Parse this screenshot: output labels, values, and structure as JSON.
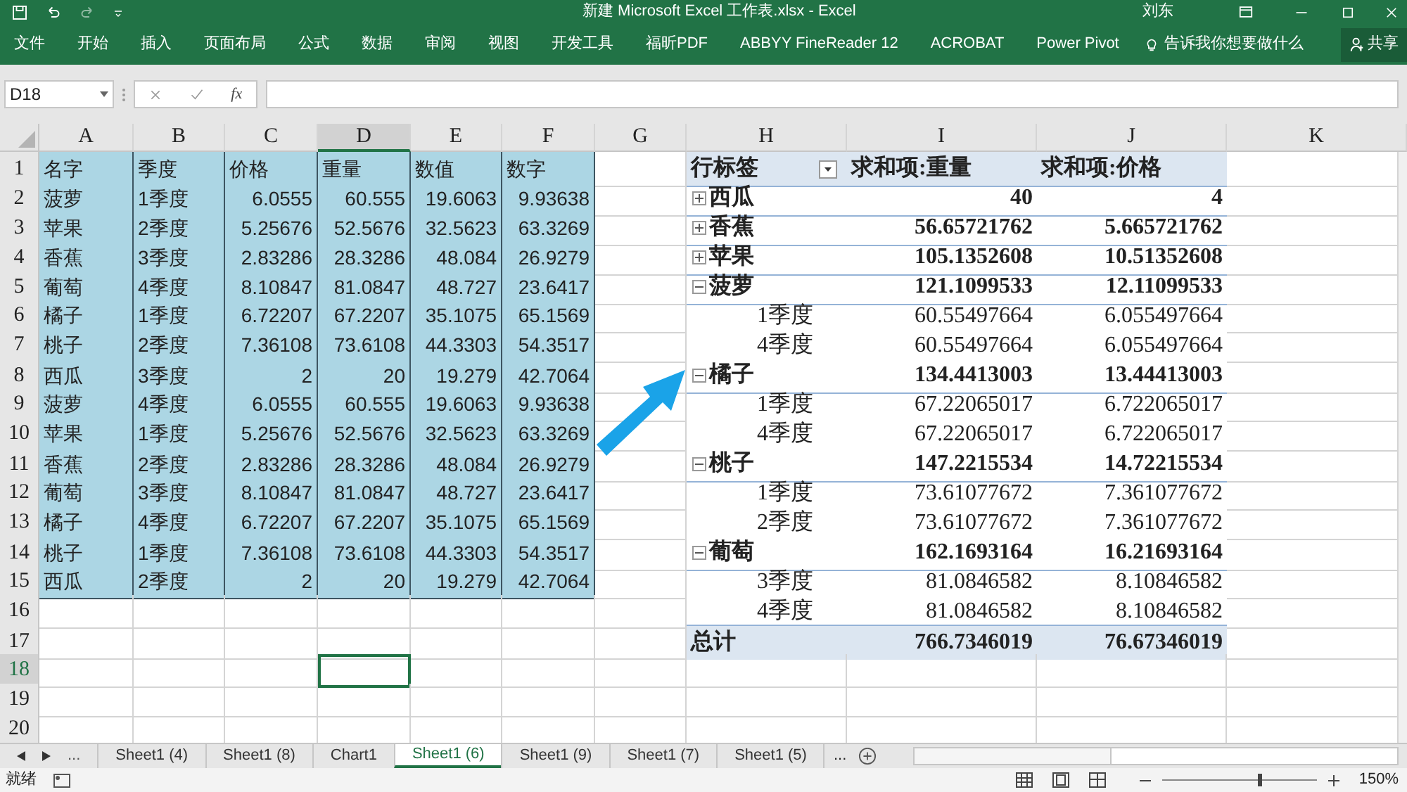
{
  "window": {
    "title": "新建 Microsoft Excel 工作表.xlsx  -  Excel",
    "user": "刘东"
  },
  "ribbon": {
    "tabs": [
      "文件",
      "开始",
      "插入",
      "页面布局",
      "公式",
      "数据",
      "审阅",
      "视图",
      "开发工具",
      "福昕PDF",
      "ABBYY FineReader 12",
      "ACROBAT",
      "Power Pivot"
    ],
    "tell_me": "告诉我你想要做什么",
    "share": "共享"
  },
  "formula_bar": {
    "name_box": "D18",
    "fx": "fx"
  },
  "columns": [
    {
      "label": "A",
      "selected": false
    },
    {
      "label": "B",
      "selected": false
    },
    {
      "label": "C",
      "selected": false
    },
    {
      "label": "D",
      "selected": true
    },
    {
      "label": "E",
      "selected": false
    },
    {
      "label": "F",
      "selected": false
    },
    {
      "label": "G",
      "selected": false
    },
    {
      "label": "H",
      "selected": false
    },
    {
      "label": "I",
      "selected": false
    },
    {
      "label": "J",
      "selected": false
    },
    {
      "label": "K",
      "selected": false
    }
  ],
  "row_numbers": [
    {
      "label": "1",
      "selected": false
    },
    {
      "label": "2",
      "selected": false
    },
    {
      "label": "3",
      "selected": false
    },
    {
      "label": "4",
      "selected": false
    },
    {
      "label": "5",
      "selected": false
    },
    {
      "label": "6",
      "selected": false
    },
    {
      "label": "7",
      "selected": false
    },
    {
      "label": "8",
      "selected": false
    },
    {
      "label": "9",
      "selected": false
    },
    {
      "label": "10",
      "selected": false
    },
    {
      "label": "11",
      "selected": false
    },
    {
      "label": "12",
      "selected": false
    },
    {
      "label": "13",
      "selected": false
    },
    {
      "label": "14",
      "selected": false
    },
    {
      "label": "15",
      "selected": false
    },
    {
      "label": "16",
      "selected": false
    },
    {
      "label": "17",
      "selected": false
    },
    {
      "label": "18",
      "selected": true
    },
    {
      "label": "19",
      "selected": false
    },
    {
      "label": "20",
      "selected": false
    }
  ],
  "table": {
    "header": [
      "名字",
      "季度",
      "价格",
      "重量",
      "数值",
      "数字"
    ],
    "rows": [
      [
        "菠萝",
        "1季度",
        "6.0555",
        "60.555",
        "19.6063",
        "9.93638"
      ],
      [
        "苹果",
        "2季度",
        "5.25676",
        "52.5676",
        "32.5623",
        "63.3269"
      ],
      [
        "香蕉",
        "3季度",
        "2.83286",
        "28.3286",
        "48.084",
        "26.9279"
      ],
      [
        "葡萄",
        "4季度",
        "8.10847",
        "81.0847",
        "48.727",
        "23.6417"
      ],
      [
        "橘子",
        "1季度",
        "6.72207",
        "67.2207",
        "35.1075",
        "65.1569"
      ],
      [
        "桃子",
        "2季度",
        "7.36108",
        "73.6108",
        "44.3303",
        "54.3517"
      ],
      [
        "西瓜",
        "3季度",
        "2",
        "20",
        "19.279",
        "42.7064"
      ],
      [
        "菠萝",
        "4季度",
        "6.0555",
        "60.555",
        "19.6063",
        "9.93638"
      ],
      [
        "苹果",
        "1季度",
        "5.25676",
        "52.5676",
        "32.5623",
        "63.3269"
      ],
      [
        "香蕉",
        "2季度",
        "2.83286",
        "28.3286",
        "48.084",
        "26.9279"
      ],
      [
        "葡萄",
        "3季度",
        "8.10847",
        "81.0847",
        "48.727",
        "23.6417"
      ],
      [
        "橘子",
        "4季度",
        "6.72207",
        "67.2207",
        "35.1075",
        "65.1569"
      ],
      [
        "桃子",
        "1季度",
        "7.36108",
        "73.6108",
        "44.3303",
        "54.3517"
      ],
      [
        "西瓜",
        "2季度",
        "2",
        "20",
        "19.279",
        "42.7064"
      ]
    ]
  },
  "pivot": {
    "header": [
      "行标签",
      "求和项:重量",
      "求和项:价格"
    ],
    "rows": [
      {
        "kind": "group",
        "expanded": false,
        "label": "西瓜",
        "values": [
          "40",
          "4"
        ]
      },
      {
        "kind": "group",
        "expanded": false,
        "label": "香蕉",
        "values": [
          "56.65721762",
          "5.665721762"
        ]
      },
      {
        "kind": "group",
        "expanded": false,
        "label": "苹果",
        "values": [
          "105.1352608",
          "10.51352608"
        ]
      },
      {
        "kind": "group",
        "expanded": true,
        "label": "菠萝",
        "values": [
          "121.1099533",
          "12.11099533"
        ]
      },
      {
        "kind": "item",
        "label": "1季度",
        "values": [
          "60.55497664",
          "6.055497664"
        ]
      },
      {
        "kind": "item",
        "label": "4季度",
        "values": [
          "60.55497664",
          "6.055497664"
        ]
      },
      {
        "kind": "group",
        "expanded": true,
        "label": "橘子",
        "values": [
          "134.4413003",
          "13.44413003"
        ]
      },
      {
        "kind": "item",
        "label": "1季度",
        "values": [
          "67.22065017",
          "6.722065017"
        ]
      },
      {
        "kind": "item",
        "label": "4季度",
        "values": [
          "67.22065017",
          "6.722065017"
        ]
      },
      {
        "kind": "group",
        "expanded": true,
        "label": "桃子",
        "values": [
          "147.2215534",
          "14.72215534"
        ]
      },
      {
        "kind": "item",
        "label": "1季度",
        "values": [
          "73.61077672",
          "7.361077672"
        ]
      },
      {
        "kind": "item",
        "label": "2季度",
        "values": [
          "73.61077672",
          "7.361077672"
        ]
      },
      {
        "kind": "group",
        "expanded": true,
        "label": "葡萄",
        "values": [
          "162.1693164",
          "16.21693164"
        ]
      },
      {
        "kind": "item",
        "label": "3季度",
        "values": [
          "81.0846582",
          "8.10846582"
        ]
      },
      {
        "kind": "item",
        "label": "4季度",
        "values": [
          "81.0846582",
          "8.10846582"
        ]
      }
    ],
    "total": {
      "label": "总计",
      "values": [
        "766.7346019",
        "76.67346019"
      ]
    }
  },
  "sheet_tabs": {
    "overflow_left": "...",
    "overflow_right": "...",
    "tabs": [
      {
        "label": "Sheet1 (4)",
        "selected": false
      },
      {
        "label": "Sheet1 (8)",
        "selected": false
      },
      {
        "label": "Chart1",
        "selected": false
      },
      {
        "label": "Sheet1 (6)",
        "selected": true
      },
      {
        "label": "Sheet1 (9)",
        "selected": false
      },
      {
        "label": "Sheet1 (7)",
        "selected": false
      },
      {
        "label": "Sheet1 (5)",
        "selected": false
      }
    ]
  },
  "status_bar": {
    "status": "就绪",
    "zoom": "150%",
    "zoom_slider": {
      "level": 0.62
    }
  }
}
